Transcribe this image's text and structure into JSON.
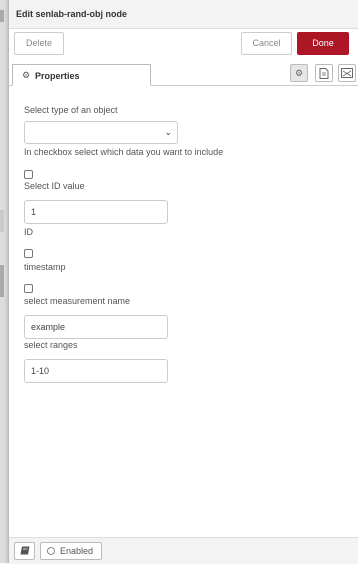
{
  "header": {
    "title": "Edit senlab-rand-obj node"
  },
  "toolbar": {
    "delete_label": "Delete",
    "cancel_label": "Cancel",
    "done_label": "Done"
  },
  "tabs": {
    "properties_label": "Properties",
    "properties_icon": "gear-icon",
    "icon_tabs": [
      "gear-icon",
      "description-icon",
      "appearance-icon"
    ]
  },
  "form": {
    "type_label": "Select type of an object",
    "type_value": "",
    "checkbox_hint": "In checkbox select which data you want to include",
    "id_checkbox_label": "Select ID value",
    "id_checked": false,
    "id_value": "1",
    "id_caption": "ID",
    "timestamp_label": "timestamp",
    "timestamp_checked": false,
    "measurement_label": "select measurement name",
    "measurement_checked": false,
    "measurement_value": "example",
    "ranges_label": "select ranges",
    "ranges_value": "1-10"
  },
  "footer": {
    "enabled_label": "Enabled",
    "help_icon": "book-icon"
  },
  "colors": {
    "done_button": "#ad1625",
    "header_bg": "#f3f3f3"
  }
}
